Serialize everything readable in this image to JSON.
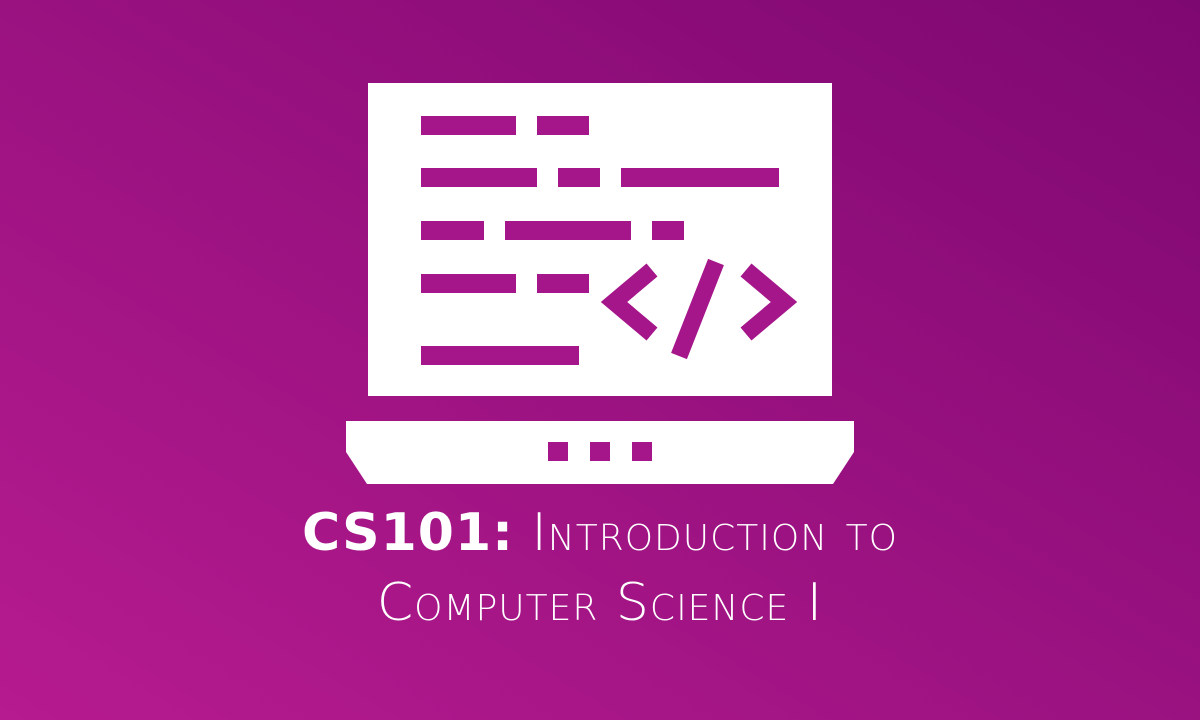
{
  "banner": {
    "course_code": "CS101:",
    "course_name_line1": "Introduction to",
    "course_name_line2": "Computer Science I",
    "icon": "laptop-code-icon",
    "colors": {
      "background_start": "#B61B8F",
      "background_end": "#7E0872",
      "foreground": "#FFFFFF"
    }
  }
}
